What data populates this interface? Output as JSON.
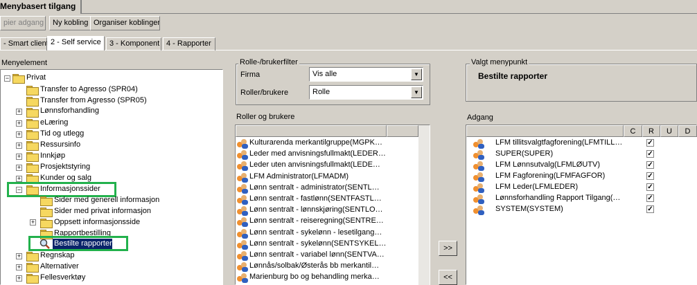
{
  "window": {
    "tab_title": "Menybasert tilgang"
  },
  "toolbar": {
    "copy_access_label": "pier adgang",
    "new_link_label": "Ny kobling",
    "organize_links_label": "Organiser koblinger"
  },
  "tabs": [
    {
      "label": "- Smart client"
    },
    {
      "label": "2 - Self service"
    },
    {
      "label": "3 - Komponent"
    },
    {
      "label": "4 - Rapporter"
    }
  ],
  "menu_tree": {
    "heading": "Menyelement",
    "items": [
      {
        "label": "Privat"
      },
      {
        "label": "Transfer to Agresso (SPR04)"
      },
      {
        "label": "Transfer from Agresso (SPR05)"
      },
      {
        "label": "Lønnsforhandling"
      },
      {
        "label": "eLæring"
      },
      {
        "label": "Tid og utlegg"
      },
      {
        "label": "Ressursinfo"
      },
      {
        "label": "Innkjøp"
      },
      {
        "label": "Prosjektstyring"
      },
      {
        "label": "Kunder og salg"
      },
      {
        "label": "Informasjonssider"
      },
      {
        "label": "Sider med generell informasjon"
      },
      {
        "label": "Sider med privat informasjon"
      },
      {
        "label": "Oppsett informasjonsside"
      },
      {
        "label": "Rapportbestilling"
      },
      {
        "label": "Bestilte rapporter"
      },
      {
        "label": "Regnskap"
      },
      {
        "label": "Alternativer"
      },
      {
        "label": "Fellesverktøy"
      }
    ]
  },
  "filter": {
    "group_title": "Rolle-/brukerfilter",
    "firma_label": "Firma",
    "firma_value": "Vis alle",
    "roles_label": "Roller/brukere",
    "roles_value": "Rolle"
  },
  "roles_list": {
    "heading": "Roller og brukere",
    "items": [
      "Kulturarenda merkantilgruppe(MGPK…",
      "Leder med anvisningsfullmakt(LEDER…",
      "Leder uten anvisningsfullmakt(LEDE…",
      "LFM Administrator(LFMADM)",
      "Lønn sentralt - administrator(SENTL…",
      "Lønn sentralt - fastlønn(SENTFASTL…",
      "Lønn sentralt - lønnskjøring(SENTLO…",
      "Lønn sentralt - reiseregning(SENTRE…",
      "Lønn sentralt - sykelønn - lesetilgang…",
      "Lønn sentralt - sykelønn(SENTSYKEL…",
      "Lønn sentralt - variabel lønn(SENTVA…",
      "Lønnås/solbak/Østerås bb merkantil…",
      "Marienburg bo og behandling merka…"
    ]
  },
  "transfer": {
    "add_label": ">>",
    "remove_label": "<<"
  },
  "selected": {
    "group_title": "Valgt menypunkt",
    "value": "Bestilte rapporter"
  },
  "access": {
    "heading": "Adgang",
    "columns": [
      "C",
      "R",
      "U",
      "D"
    ],
    "rows": [
      {
        "name": "LFM tillitsvalgtfagforening(LFMTILL…",
        "r": true
      },
      {
        "name": "SUPER(SUPER)",
        "r": true
      },
      {
        "name": "LFM Lønnsutvalg(LFMLØUTV)",
        "r": true
      },
      {
        "name": "LFM Fagforening(LFMFAGFOR)",
        "r": true
      },
      {
        "name": "LFM Leder(LFMLEDER)",
        "r": true
      },
      {
        "name": "Lønnsforhandling Rapport Tilgang(…",
        "r": true
      },
      {
        "name": "SYSTEM(SYSTEM)",
        "r": true
      }
    ]
  },
  "colors": {
    "highlight": "#0a246a",
    "annotation_green": "#22b14c"
  }
}
